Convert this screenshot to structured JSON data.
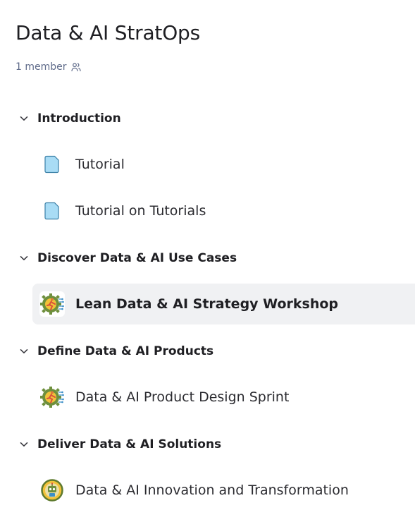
{
  "workspace": {
    "title": "Data & AI StratOps",
    "members_label": "1 member",
    "members_icon": "people-icon"
  },
  "sections": [
    {
      "label": "Introduction",
      "expanded": true,
      "items": [
        {
          "label": "Tutorial",
          "icon": "document-icon"
        },
        {
          "label": "Tutorial on Tutorials",
          "icon": "document-icon"
        }
      ]
    },
    {
      "label": "Discover Data & AI Use Cases",
      "expanded": true,
      "items": [
        {
          "label": "Lean Data & AI Strategy Workshop",
          "icon": "gear-runner-icon",
          "selected": true
        }
      ]
    },
    {
      "label": "Define Data & AI Products",
      "expanded": true,
      "items": [
        {
          "label": "Data & AI Product Design Sprint",
          "icon": "gear-runner-icon"
        }
      ]
    },
    {
      "label": "Deliver Data & AI Solutions",
      "expanded": true,
      "items": [
        {
          "label": "Data & AI Innovation and Transformation",
          "icon": "robot-badge-icon"
        }
      ]
    }
  ],
  "colors": {
    "text": "#1f1f23",
    "muted": "#5f6b8a",
    "selected_bg": "#f0f1f3",
    "doc_icon_fill": "#a9dcf5",
    "doc_icon_stroke": "#3a7fa6"
  }
}
